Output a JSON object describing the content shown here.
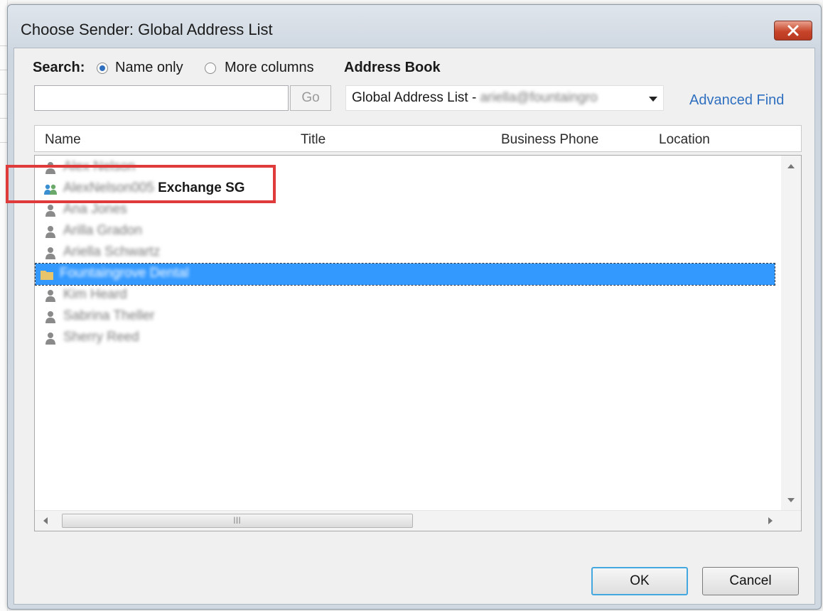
{
  "window": {
    "title": "Choose Sender: Global Address List"
  },
  "search": {
    "label": "Search:",
    "options": [
      {
        "label": "Name only",
        "selected": true
      },
      {
        "label": "More columns",
        "selected": false
      }
    ],
    "value": "",
    "go_label": "Go"
  },
  "address_book": {
    "label": "Address Book",
    "selected_prefix": "Global Address List -",
    "selected_suffix": "ariella@fountaingro"
  },
  "advanced_find": "Advanced Find",
  "columns": [
    "Name",
    "Title",
    "Business Phone",
    "Location"
  ],
  "rows": [
    {
      "name": "Alex Nelson",
      "suffix": "",
      "icon": "person-icon",
      "blurred": true,
      "selected": false
    },
    {
      "name": "AlexNelson005",
      "suffix": "Exchange SG",
      "icon": "group-icon",
      "blurred": true,
      "selected": false
    },
    {
      "name": "Ana Jones",
      "suffix": "",
      "icon": "person-icon",
      "blurred": true,
      "selected": false
    },
    {
      "name": "Arilla Gradon",
      "suffix": "",
      "icon": "person-icon",
      "blurred": true,
      "selected": false
    },
    {
      "name": "Ariella Schwartz",
      "suffix": "",
      "icon": "person-icon",
      "blurred": true,
      "selected": false
    },
    {
      "name": "Fountaingrove Dental",
      "suffix": "",
      "icon": "folder-icon",
      "blurred": true,
      "selected": true
    },
    {
      "name": "Kim Heard",
      "suffix": "",
      "icon": "person-icon",
      "blurred": true,
      "selected": false
    },
    {
      "name": "Sabrina Theller",
      "suffix": "",
      "icon": "person-icon",
      "blurred": true,
      "selected": false
    },
    {
      "name": "Sherry Reed",
      "suffix": "",
      "icon": "person-icon",
      "blurred": true,
      "selected": false
    }
  ],
  "buttons": {
    "ok": "OK",
    "cancel": "Cancel"
  },
  "colors": {
    "accent": "#2f6fbf",
    "selection": "#3399ff",
    "highlight": "#e03b3b"
  }
}
